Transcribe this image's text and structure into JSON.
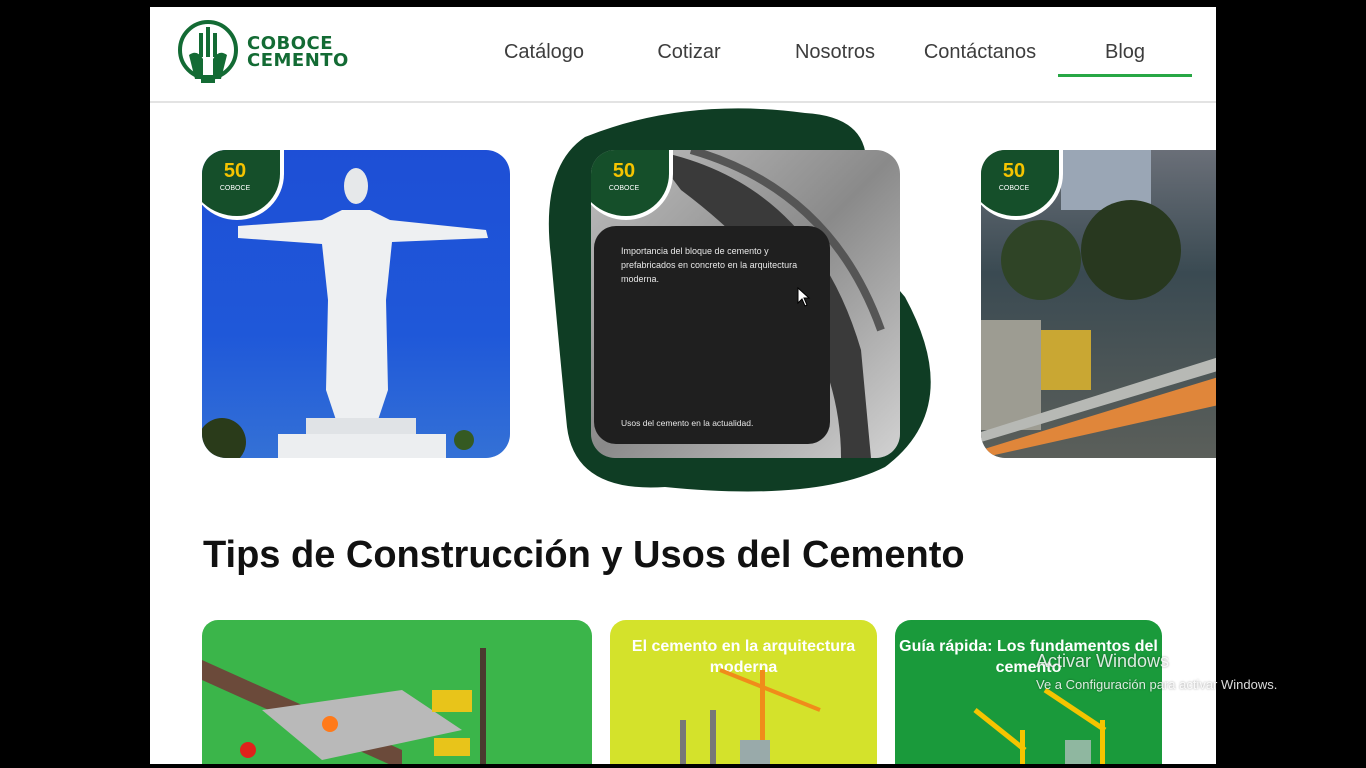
{
  "brand": {
    "name_line1": "COBOCE",
    "name_line2": "CEMENTO",
    "color": "#136b34"
  },
  "nav": {
    "items": [
      {
        "label": "Catálogo"
      },
      {
        "label": "Cotizar"
      },
      {
        "label": "Nosotros"
      },
      {
        "label": "Contáctanos"
      },
      {
        "label": "Blog",
        "active": true
      }
    ],
    "accent": "#28a745"
  },
  "carousel": {
    "badge_text": "50",
    "badge_brand": "COBOCE",
    "center_card": {
      "text": "Importancia del bloque de cemento y prefabricados en concreto en la arquitectura moderna.",
      "footer": "Usos del cemento en la actualidad."
    }
  },
  "section": {
    "title": "Tips de Construcción y Usos del Cemento"
  },
  "tips": [
    {
      "label": "",
      "color": "#3bb54a"
    },
    {
      "label": "El cemento en la arquitectura moderna",
      "color": "#d4e22b"
    },
    {
      "label": "Guía rápida: Los fundamentos del cemento",
      "color": "#1a9a3b"
    }
  ],
  "watermark": {
    "title": "Activar Windows",
    "subtitle": "Ve a Configuración para activar Windows."
  }
}
